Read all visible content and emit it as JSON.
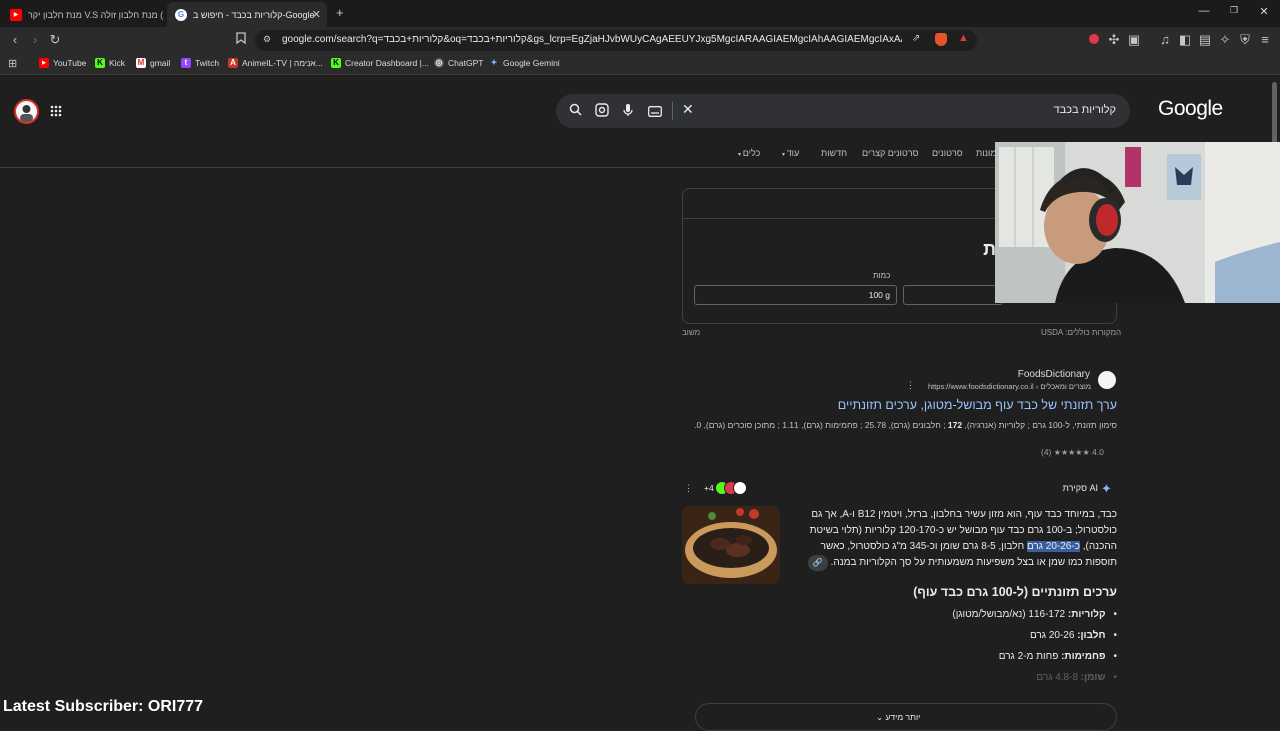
{
  "browser": {
    "tabs": [
      {
        "label": "(1) מנת חלבון זולה V.S מנת חלבון יקר",
        "active": false
      },
      {
        "label": "קלוריות בכבד - חיפוש ב-Google",
        "active": true
      }
    ],
    "new_tab": "+",
    "url": "google.com/search?q=קלוריות+בכבד&oq=קלוריות+בכבד&gs_lcrp=EgZjaHJvbWUyCAgAEEUYJxg5MgcIARAAGIAEMgcIAhAAGIAEMgcIAxAAGIAEMgcl...",
    "bookmarks": [
      "YouTube",
      "Kick",
      "gmail",
      "Twitch",
      "AnimeIL-TV | אנימה...",
      "Creator Dashboard |...",
      "ChatGPT",
      "Google Gemini"
    ],
    "colors": {
      "youtube": "#ff0000",
      "kick": "#53fc18",
      "twitch": "#9146ff"
    }
  },
  "google": {
    "logo": "Google",
    "query": "קלוריות בכבד",
    "tabs": [
      "כלים",
      "עוד",
      "חדשות",
      "סרטונים קצרים",
      "סרטונים",
      "תמונות"
    ]
  },
  "nutrition_card": {
    "title_fragment": "ת",
    "quantity_label": "כמות",
    "quantity_value": "100 g",
    "source": "המקורות כוללים: USDA",
    "feedback": "משוב"
  },
  "result1": {
    "site_name": "FoodsDictionary",
    "site_url": "https://www.foodsdictionary.co.il › מוצרים ומאכלים",
    "title": "ערך תזונתי של כבד עוף מבושל-מטוגן, ערכים תזונתיים",
    "snippet_a": "סימון תזונתי, ל-100 גרם ; קלוריות (אנרגיה), ",
    "snippet_bold": "172",
    "snippet_b": " ; חלבונים (גרם), 25.78 ; פחמימות (גרם), 1.11 ; מתוכן סוכרים (גרם), 0.",
    "rating": "4.0",
    "stars": "★★★★★",
    "reviews": "(4)"
  },
  "ai_overview": {
    "label": "סקירת AI",
    "sources_more": "+4",
    "para_a": "כבד, במיוחד כבד עוף, הוא מזון עשיר בחלבון, ברזל, ויטמין B12 ו-A, אך גם כולסטרול; ב-100 גרם כבד עוף מבושל יש כ-120-170 קלוריות (תלוי בשיטת ההכנה), ",
    "para_hl": "כ-20-26 גרם",
    "para_b": " חלבון, 8-5 גרם שומן וכ-345 מ\"ג כולסטרול, כאשר תוספות כמו שמן או בצל משפיעות משמעותית על סך הקלוריות במנה.",
    "heading": "ערכים תזונתיים (ל-100 גרם כבד עוף)",
    "items": [
      {
        "label": "קלוריות:",
        "value": " 116-172 (נא/מבושל/מטוגן)"
      },
      {
        "label": "חלבון:",
        "value": " 20-26 גרם"
      },
      {
        "label": "פחמימות:",
        "value": " פחות מ-2 גרם"
      },
      {
        "label": "שומן:",
        "value": " 4.8-8 גרם"
      }
    ],
    "more": "יותר מידע"
  },
  "overlay": {
    "subscriber": "Latest Subscriber: ORI777"
  }
}
